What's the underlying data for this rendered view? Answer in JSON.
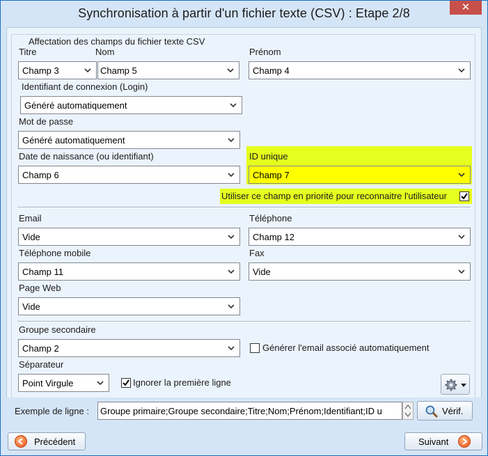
{
  "window": {
    "title": "Synchronisation à partir d'un fichier texte (CSV) : Etape 2/8",
    "close_glyph": "✕"
  },
  "group": {
    "legend": "Affectation des champs du fichier texte CSV"
  },
  "fields": {
    "titre": {
      "label": "Titre",
      "value": "Champ 3"
    },
    "nom": {
      "label": "Nom",
      "value": "Champ 5"
    },
    "prenom": {
      "label": "Prénom",
      "value": "Champ 4"
    },
    "login": {
      "label": "Identifiant de connexion (Login)",
      "value": "Généré automatiquement"
    },
    "password": {
      "label": "Mot de passe",
      "value": "Généré automatiquement"
    },
    "birthdate": {
      "label": "Date de naissance (ou identifiant)",
      "value": "Champ 6"
    },
    "unique_id": {
      "label": "ID unique",
      "value": "Champ 7"
    },
    "priority": {
      "label": "Utiliser ce champ en priorité pour reconnaitre l'utilisateur",
      "checked": true
    },
    "email": {
      "label": "Email",
      "value": "Vide"
    },
    "phone": {
      "label": "Téléphone",
      "value": "Champ 12"
    },
    "mobile": {
      "label": "Téléphone mobile",
      "value": "Champ 11"
    },
    "fax": {
      "label": "Fax",
      "value": "Vide"
    },
    "web": {
      "label": "Page Web",
      "value": "Vide"
    },
    "secondary_group": {
      "label": "Groupe secondaire",
      "value": "Champ 2"
    },
    "gen_email": {
      "label": "Générer l'email associé automatiquement",
      "checked": false
    },
    "separator": {
      "label": "Séparateur",
      "value": "Point Virgule"
    },
    "ignore_first": {
      "label": "Ignorer la première ligne",
      "checked": true
    }
  },
  "example": {
    "label": "Exemple de ligne :",
    "value": "Groupe primaire;Groupe secondaire;Titre;Nom;Prénom;Identifiant;ID u",
    "verify_label": "Vérif."
  },
  "nav": {
    "prev_label": "Précédent",
    "next_label": "Suivant"
  },
  "colors": {
    "highlight": "#e5ff1e",
    "window_border": "#1a6fc6",
    "close": "#c7504b"
  }
}
